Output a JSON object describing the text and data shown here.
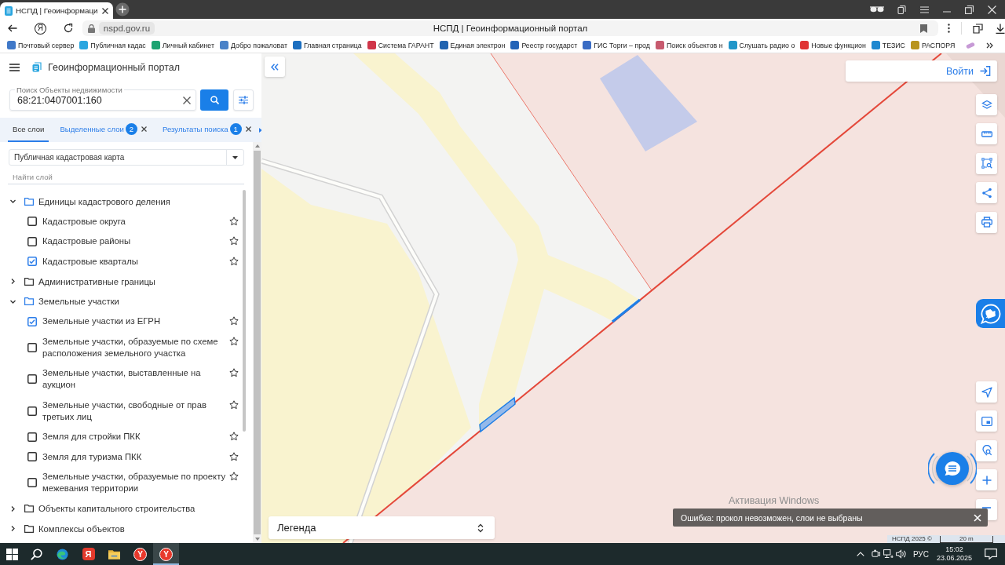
{
  "browser": {
    "tab": {
      "title": "НСПД | Геоинформаци"
    },
    "toolbar": {
      "home_glyph": "Я",
      "url": "nspd.gov.ru",
      "page_title": "НСПД | Геоинформационный портал"
    },
    "bookmarks": [
      {
        "label": "Почтовый сервер",
        "color": "#3f78c8"
      },
      {
        "label": "Публичная кадас",
        "color": "#2aa6e0"
      },
      {
        "label": "Личный кабинет",
        "color": "#1da371"
      },
      {
        "label": "Добро пожаловат",
        "color": "#4a82c8"
      },
      {
        "label": "Главная страница",
        "color": "#1c6fc0"
      },
      {
        "label": "Система ГАРАНТ",
        "color": "#d0364a"
      },
      {
        "label": "Единая электрон",
        "color": "#2063b0"
      },
      {
        "label": "Реестр государст",
        "color": "#2364b8"
      },
      {
        "label": "ГИС Торги – прод",
        "color": "#3a6cc4"
      },
      {
        "label": "Поиск объектов н",
        "color": "#c75a6e"
      },
      {
        "label": "Слушать радио о",
        "color": "#2196c9"
      },
      {
        "label": "Новые функцион",
        "color": "#e03333"
      },
      {
        "label": "ТЕЗИС",
        "color": "#1e88d0"
      },
      {
        "label": "РАСПОРЯ",
        "color": "#b8941c"
      }
    ]
  },
  "sidebar": {
    "title": "Геоинформационный портал",
    "search": {
      "label": "Поиск Объекты недвижимости",
      "value": "68:21:0407001:160"
    },
    "tabs": [
      {
        "label": "Все слои",
        "closable": false,
        "selected": true
      },
      {
        "label": "Выделенные слои",
        "badge": "2",
        "closable": true,
        "selected": false
      },
      {
        "label": "Результаты поиска",
        "badge": "1",
        "closable": true,
        "selected": false
      }
    ],
    "basemap_select": {
      "value": "Публичная кадастровая карта"
    },
    "layer_filter": {
      "placeholder": "Найти слой"
    },
    "layers": [
      {
        "label": "Единицы кадастрового деления",
        "expanded": true,
        "children": [
          {
            "label": "Кадастровые округа",
            "checked": false
          },
          {
            "label": "Кадастровые районы",
            "checked": false
          },
          {
            "label": "Кадастровые кварталы",
            "checked": true
          }
        ]
      },
      {
        "label": "Административные границы",
        "expanded": false
      },
      {
        "label": "Земельные участки",
        "expanded": true,
        "children": [
          {
            "label": "Земельные участки из ЕГРН",
            "checked": true
          },
          {
            "label": "Земельные участки, образуемые по схеме расположения земельного участка",
            "checked": false
          },
          {
            "label": "Земельные участки, выставленные на аукцион",
            "checked": false
          },
          {
            "label": "Земельные участки, свободные от прав третьих лиц",
            "checked": false
          },
          {
            "label": "Земля для стройки ПКК",
            "checked": false
          },
          {
            "label": "Земля для туризма ПКК",
            "checked": false
          },
          {
            "label": "Земельные участки, образуемые по проекту межевания территории",
            "checked": false
          }
        ]
      },
      {
        "label": "Объекты капитального строительства",
        "expanded": false
      },
      {
        "label": "Комплексы объектов",
        "expanded": false
      }
    ]
  },
  "map": {
    "login": "Войти",
    "legend": "Легенда",
    "activation_notice": "Активация Windows",
    "error_toast": "Ошибка: прокол невозможен, слои не выбраны",
    "attribution": "НСПД 2025 ©",
    "scale": "20 m"
  },
  "taskbar": {
    "apps": [
      {
        "kind": "start",
        "selected": false
      },
      {
        "kind": "search",
        "selected": false
      },
      {
        "kind": "edge",
        "selected": false
      },
      {
        "kind": "yandex",
        "glyph": "Я",
        "selected": false
      },
      {
        "kind": "explorer",
        "selected": false
      },
      {
        "kind": "yabrowser",
        "glyph": "Y",
        "selected": false
      },
      {
        "kind": "yabrowser",
        "glyph": "Y",
        "selected": true
      }
    ],
    "language": "РУС",
    "time": "15:02",
    "date": "23.06.2025"
  }
}
